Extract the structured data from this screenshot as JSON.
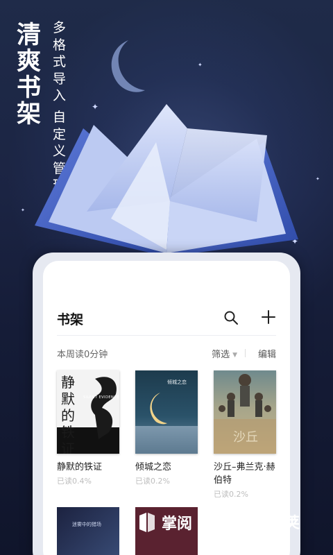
{
  "promo": {
    "headline": "清爽书架",
    "tagline_col1": "多格式导入",
    "tagline_col2": "自定义管理"
  },
  "bookshelf": {
    "title": "书架",
    "weekly_reading": "本周读0分钟",
    "filter_label": "筛选",
    "edit_label": "编辑",
    "books": [
      {
        "title": "静默的铁证",
        "progress": "已读0.4%",
        "cover_title": "静默的铁证",
        "cover_subtitle": "SILENT EVIDENCE"
      },
      {
        "title": "倾城之恋",
        "progress": "已读0.2%",
        "cover_title": "倾城之恋"
      },
      {
        "title": "沙丘–弗兰克·赫伯特",
        "progress": "已读0.2%",
        "cover_title": "沙丘"
      }
    ],
    "row2_partial_cover_text": "迷雾中的猎场"
  },
  "logos": {
    "zhangyue": "掌阅",
    "wandoujia": "豌豆荚"
  },
  "colors": {
    "background": "#1b2443",
    "card": "#ffffff",
    "text_primary": "#222222",
    "text_muted": "#bdbdbd"
  },
  "icons": [
    "search-icon",
    "plus-icon",
    "dropdown-caret-icon",
    "moon-icon",
    "star-icon",
    "open-book-illustration",
    "zhangyue-logo-icon",
    "wandoujia-logo-icon"
  ]
}
